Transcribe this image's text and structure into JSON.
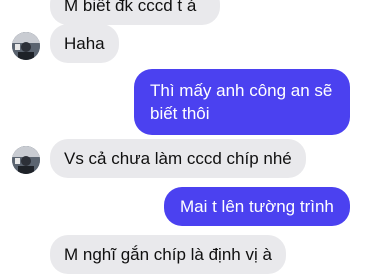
{
  "messages": [
    {
      "side": "in",
      "text": "M biết đk cccd t á"
    },
    {
      "side": "in",
      "text": "Haha"
    },
    {
      "side": "out",
      "text": "Thì mấy anh công an sẽ biết thôi",
      "lines": [
        "Thì mấy anh công an sẽ",
        "biết thôi"
      ]
    },
    {
      "side": "in",
      "text": "Vs cả chưa làm cccd chíp nhé"
    },
    {
      "side": "out",
      "text": "Mai t lên tường trình"
    },
    {
      "side": "in",
      "text": "M nghĩ gắn chíp là định vị à"
    }
  ],
  "colors": {
    "incoming_bubble": "#e9e9ec",
    "outgoing_bubble": "#4b41f0"
  }
}
